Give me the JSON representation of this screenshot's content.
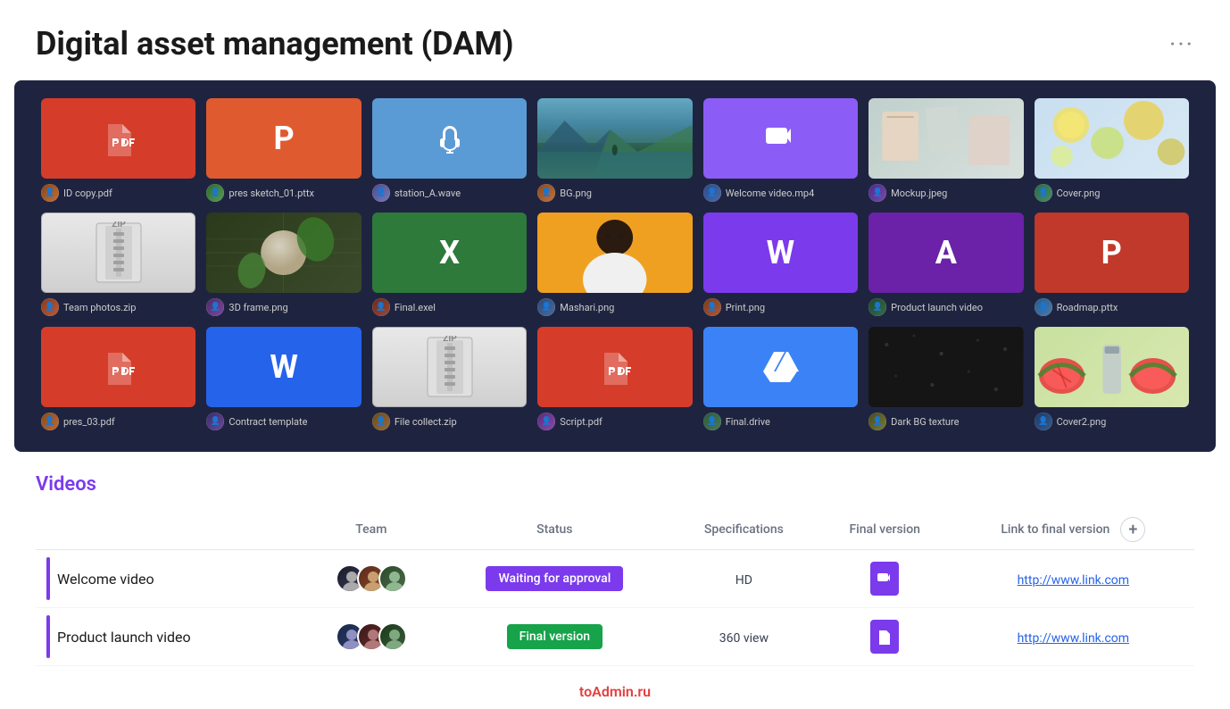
{
  "header": {
    "title": "Digital asset management (DAM)",
    "menu_label": "···"
  },
  "grid": {
    "assets": [
      {
        "id": "id-copy-pdf",
        "name": "ID copy.pdf",
        "type": "pdf",
        "bg": "bg-red",
        "row": 1
      },
      {
        "id": "pres-sketch-pttx",
        "name": "pres sketch_01.pttx",
        "type": "powerpoint",
        "bg": "bg-orange-red",
        "row": 1
      },
      {
        "id": "station-wave",
        "name": "station_A.wave",
        "type": "audio",
        "bg": "bg-blue",
        "row": 1
      },
      {
        "id": "bg-png",
        "name": "BG.png",
        "type": "image-nature",
        "bg": "bg-nature",
        "row": 1
      },
      {
        "id": "welcome-video-mp4",
        "name": "Welcome video.mp4",
        "type": "video",
        "bg": "bg-purple",
        "row": 1
      },
      {
        "id": "mockup-jpeg",
        "name": "Mockup.jpeg",
        "type": "image-mockup",
        "bg": "bg-mockup",
        "row": 1
      },
      {
        "id": "cover-png",
        "name": "Cover.png",
        "type": "image-cover",
        "bg": "bg-cover",
        "row": 1
      },
      {
        "id": "team-photos-zip",
        "name": "Team photos.zip",
        "type": "zip",
        "bg": "bg-zip",
        "row": 2
      },
      {
        "id": "3d-frame-png",
        "name": "3D frame.png",
        "type": "image-3d",
        "bg": "bg-3d",
        "row": 2
      },
      {
        "id": "final-exel",
        "name": "Final.exel",
        "type": "excel",
        "bg": "bg-green",
        "row": 2
      },
      {
        "id": "mashari-png",
        "name": "Mashari.png",
        "type": "image-person",
        "bg": "bg-orange",
        "row": 2
      },
      {
        "id": "print-png",
        "name": "Print.png",
        "type": "word",
        "bg": "bg-purple-w",
        "row": 2
      },
      {
        "id": "product-launch-video",
        "name": "Product launch video",
        "type": "acrobat",
        "bg": "bg-purple-a",
        "row": 2
      },
      {
        "id": "roadmap-pttx",
        "name": "Roadmap.pttx",
        "type": "powerpoint2",
        "bg": "bg-orange-p",
        "row": 2
      },
      {
        "id": "pres-03-pdf",
        "name": "pres_03.pdf",
        "type": "pdf",
        "bg": "bg-red",
        "row": 3
      },
      {
        "id": "contract-template",
        "name": "Contract template",
        "type": "word",
        "bg": "bg-blue-w",
        "row": 3
      },
      {
        "id": "file-collect-zip",
        "name": "File collect.zip",
        "type": "zip",
        "bg": "bg-zip",
        "row": 3
      },
      {
        "id": "script-pdf",
        "name": "Script.pdf",
        "type": "pdf",
        "bg": "bg-red",
        "row": 3
      },
      {
        "id": "final-drive",
        "name": "Final.drive",
        "type": "drive",
        "bg": "bg-blue-drive",
        "row": 3
      },
      {
        "id": "dark-bg-texture",
        "name": "Dark BG texture",
        "type": "image-dark",
        "bg": "bg-dark-texture",
        "row": 3
      },
      {
        "id": "cover2-png",
        "name": "Cover2.png",
        "type": "image-cover2",
        "bg": "bg-cover2",
        "row": 3
      }
    ]
  },
  "videos_section": {
    "title": "Videos",
    "columns": {
      "name": "",
      "team": "Team",
      "status": "Status",
      "specifications": "Specifications",
      "final_version": "Final version",
      "link_to_final_version": "Link to final version"
    },
    "rows": [
      {
        "id": "welcome-video-row",
        "name": "Welcome video",
        "team_count": 3,
        "status": "Waiting for approval",
        "status_type": "waiting",
        "specifications": "HD",
        "final_version_type": "video-purple",
        "link": "http://www.link.com",
        "indicator_color": "#7c3aed"
      },
      {
        "id": "product-launch-row",
        "name": "Product launch video",
        "team_count": 3,
        "status": "Final version",
        "status_type": "final",
        "specifications": "360 view",
        "final_version_type": "doc-purple",
        "link": "http://www.link.com",
        "indicator_color": "#7c3aed"
      }
    ],
    "add_column_label": "+"
  },
  "watermark": "toAdmin.ru"
}
